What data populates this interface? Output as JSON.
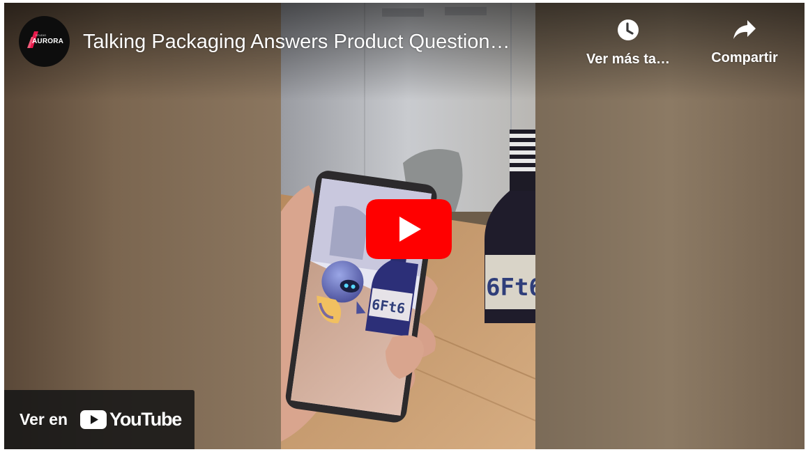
{
  "player": {
    "title": "Talking Packaging Answers Product Question…",
    "channel": {
      "name": "AURORA",
      "tagline": "STUDIO"
    },
    "actions": {
      "watch_later": {
        "label": "Ver más ta…",
        "icon": "clock-icon"
      },
      "share": {
        "label": "Compartir",
        "icon": "share-arrow-icon"
      }
    },
    "play_button": {
      "icon": "play-icon",
      "color": "#ff0000"
    },
    "watch_on": {
      "prefix": "Ver en",
      "brand": "YouTube",
      "icon": "youtube-logo-icon"
    },
    "bottle_label": "6Ft6",
    "phone_bottle_label": "6Ft6"
  }
}
